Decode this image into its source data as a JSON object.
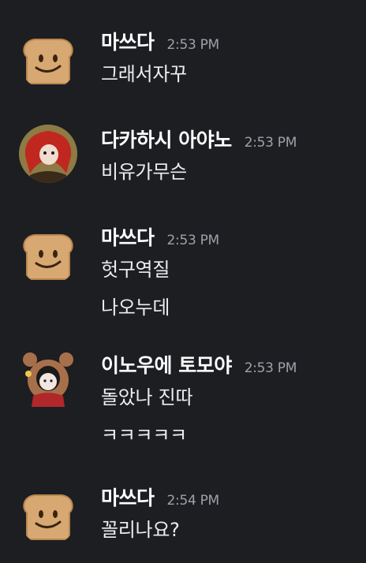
{
  "messages": [
    {
      "username": "마쓰다",
      "time": "2:53 PM",
      "avatar": "toast-face-icon",
      "lines": [
        "그래서자꾸"
      ]
    },
    {
      "username": "다카하시 아야노",
      "time": "2:53 PM",
      "avatar": "red-hair-character-avatar",
      "lines": [
        "비유가무슨"
      ]
    },
    {
      "username": "마쓰다",
      "time": "2:53 PM",
      "avatar": "toast-face-icon",
      "lines": [
        "헛구역질",
        "나오누데"
      ]
    },
    {
      "username": "이노우에 토모야",
      "time": "2:53 PM",
      "avatar": "bear-hood-character-avatar",
      "lines": [
        "돌았나 진따",
        "ㅋㅋㅋㅋㅋ"
      ]
    },
    {
      "username": "마쓰다",
      "time": "2:54 PM",
      "avatar": "toast-face-icon",
      "lines": [
        "꼴리나요?"
      ]
    }
  ],
  "colors": {
    "background": "#1d1e22",
    "username": "#ffffff",
    "timestamp": "#9ea1a8",
    "message_text": "#eceef1",
    "toast": "#d8a872"
  }
}
